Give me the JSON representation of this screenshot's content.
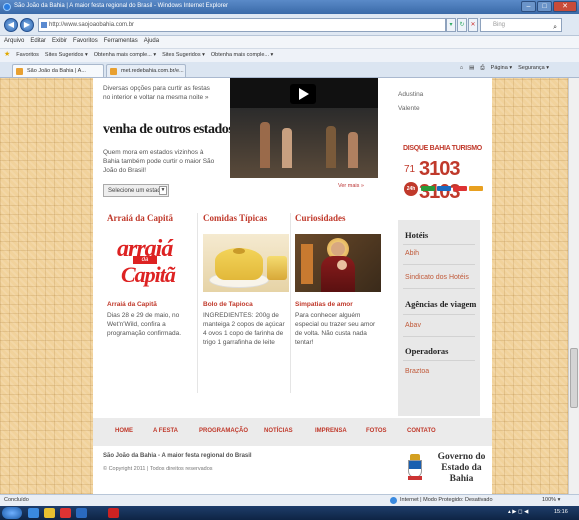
{
  "window": {
    "title": "São João da Bahia | A maior festa regional do Brasil - Windows Internet Explorer",
    "min": "–",
    "max": "□",
    "close": "✕"
  },
  "addressbar": {
    "url": "http://www.saojoaobahia.com.br",
    "search_placeholder": "Bing",
    "back": "◀",
    "forward": "▶"
  },
  "menubar": [
    "Arquivo",
    "Editar",
    "Exibir",
    "Favoritos",
    "Ferramentas",
    "Ajuda"
  ],
  "favbar": {
    "label": "Favoritos",
    "items": [
      "Sites Sugeridos ▾",
      "Obtenha mais comple... ▾",
      "Sites Sugeridos ▾",
      "Obtenha mais comple... ▾"
    ]
  },
  "tabs": {
    "tab1": "São João da Bahia | A...",
    "tab2": "met.redebahia.com.br/e...",
    "commands": [
      "Página ▾",
      "Segurança ▾"
    ]
  },
  "intro": {
    "text": "Diversas opções para curtir as festas no interior e voltar na mesma noite »"
  },
  "venha": {
    "title": "venha de outros estados",
    "text": "Quem mora em estados vizinhos à Bahia também pode curtir o maior São João do Brasil!",
    "select_label": "Selecione um estado"
  },
  "video": {
    "ver_mais": "Ver mais »"
  },
  "sponsors": [
    "Adustina",
    "Valente"
  ],
  "disque": {
    "title": "DISQUE BAHIA TURISMO",
    "prefix": "71",
    "number": "3103 3103",
    "badge": "24h"
  },
  "columns": [
    {
      "title": "Arraiá da Capitã",
      "subtitle": "Arraiá da Capitã",
      "text": "Dias 28 e 29 de maio, no Wet'n'Wild, confira a programação confirmada."
    },
    {
      "title": "Comidas Típicas",
      "subtitle": "Bolo de Tapioca",
      "text": "INGREDIENTES: 200g de manteiga 2 copos de açúcar 4 ovos 1 copo de farinha de trigo 1 garrafinha de leite"
    },
    {
      "title": "Curiosidades",
      "subtitle": "Simpatias de amor",
      "text": "Para conhecer alguém especial ou trazer seu amor de volta. Não custa nada tentar!"
    }
  ],
  "logo_arraia": {
    "l1": "arraiá",
    "l2": "da",
    "l3": "Capitã"
  },
  "sidebar": {
    "hoteis": "Hotéis",
    "abih": "Abih",
    "sindicato": "Sindicato dos Hotéis",
    "agencias": "Agências de viagem",
    "abav": "Abav",
    "operadoras": "Operadoras",
    "braztoa": "Braztoa"
  },
  "footnav": [
    "HOME",
    "A FESTA",
    "PROGRAMAÇÃO",
    "NOTÍCIAS",
    "IMPRENSA",
    "FOTOS",
    "CONTATO"
  ],
  "footer": {
    "tagline": "São João da Bahia - A maior festa regional do Brasil",
    "copyright": "© Copyright 2011 | Todos direitos reservados",
    "gov_line1": "Governo do",
    "gov_line2": "Estado da Bahia"
  },
  "statusbar": {
    "left": "Concluído",
    "mid": "Internet | Modo Protegido: Desativado",
    "zoom": "100% ▾"
  },
  "taskbar": {
    "clock": "15:16",
    "tray": "▴ ▶ ◻ ◀"
  },
  "colors": {
    "accent_red": "#c0392b",
    "page_bg": "#f1d29b",
    "ie_blue": "#3a6aa8"
  }
}
